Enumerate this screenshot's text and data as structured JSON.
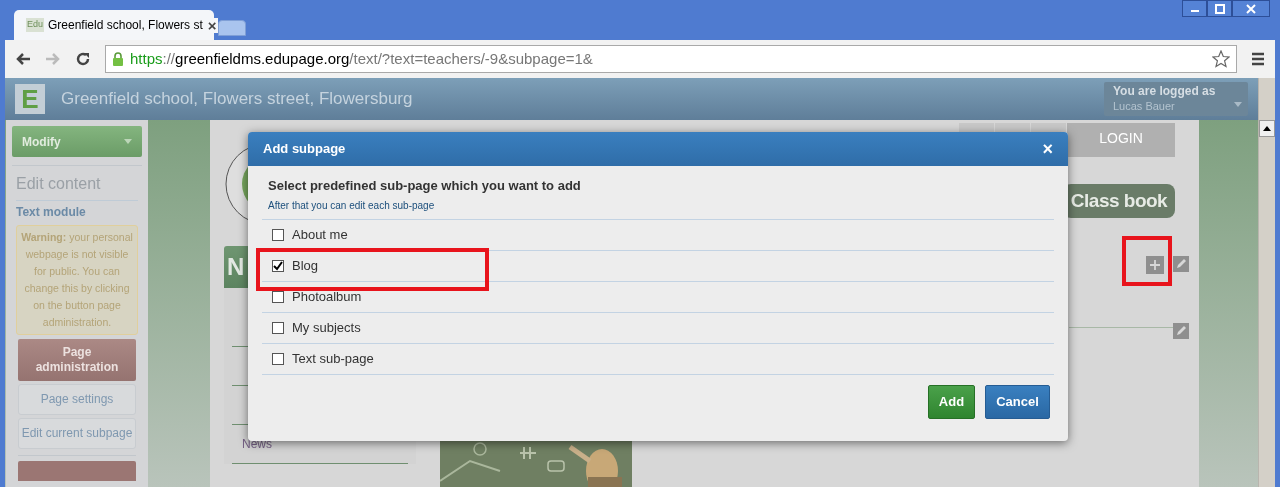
{
  "browser": {
    "tab": {
      "favicon": "Edu",
      "title": "Greenfield school, Flowers st",
      "close": "×"
    },
    "url": {
      "scheme": "https",
      "separator": "://",
      "host": "greenfieldms.edupage.org",
      "path": "/text/?text=teachers/-9&subpage=1&"
    }
  },
  "header": {
    "logo": "E",
    "title": "Greenfield school, Flowers street, Flowersburg",
    "login_label": "You are logged as",
    "user": "Lucas Bauer"
  },
  "sidebar": {
    "modify": "Modify",
    "section": "Edit content",
    "module": "Text module",
    "warning": "**Warning:** your personal webpage is not visible for public. You can change this by clicking on the button page administration.",
    "buttons": [
      {
        "label": "Page administration",
        "kind": "primary"
      },
      {
        "label": "Page settings",
        "kind": "plain"
      },
      {
        "label": "Edit current subpage",
        "kind": "plain"
      }
    ]
  },
  "page": {
    "login": "LOGIN",
    "class_book": "Class book",
    "nav_heading": "N",
    "nav_items": [
      "News"
    ]
  },
  "dialog": {
    "title": "Add subpage",
    "close": "×",
    "heading": "Select predefined sub-page which you want to add",
    "hint": "After that you can edit each sub-page",
    "options": [
      {
        "label": "About me",
        "checked": false
      },
      {
        "label": "Blog",
        "checked": true
      },
      {
        "label": "Photoalbum",
        "checked": false
      },
      {
        "label": "My subjects",
        "checked": false
      },
      {
        "label": "Text sub-page",
        "checked": false
      }
    ],
    "buttons": [
      {
        "label": "Add",
        "kind": "confirm"
      },
      {
        "label": "Cancel",
        "kind": "cancel"
      }
    ]
  }
}
